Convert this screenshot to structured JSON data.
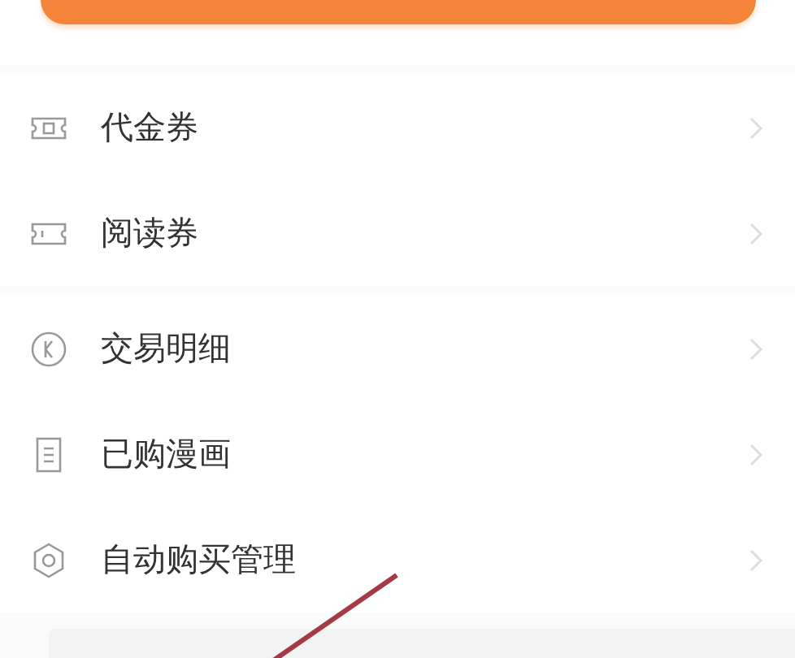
{
  "groups": [
    {
      "items": [
        {
          "label": "代金券",
          "kind": "voucher"
        },
        {
          "label": "阅读券",
          "kind": "ticket"
        }
      ]
    },
    {
      "items": [
        {
          "label": "交易明细",
          "kind": "transactions"
        },
        {
          "label": "已购漫画",
          "kind": "purchased"
        },
        {
          "label": "自动购买管理",
          "kind": "settings"
        }
      ]
    }
  ]
}
